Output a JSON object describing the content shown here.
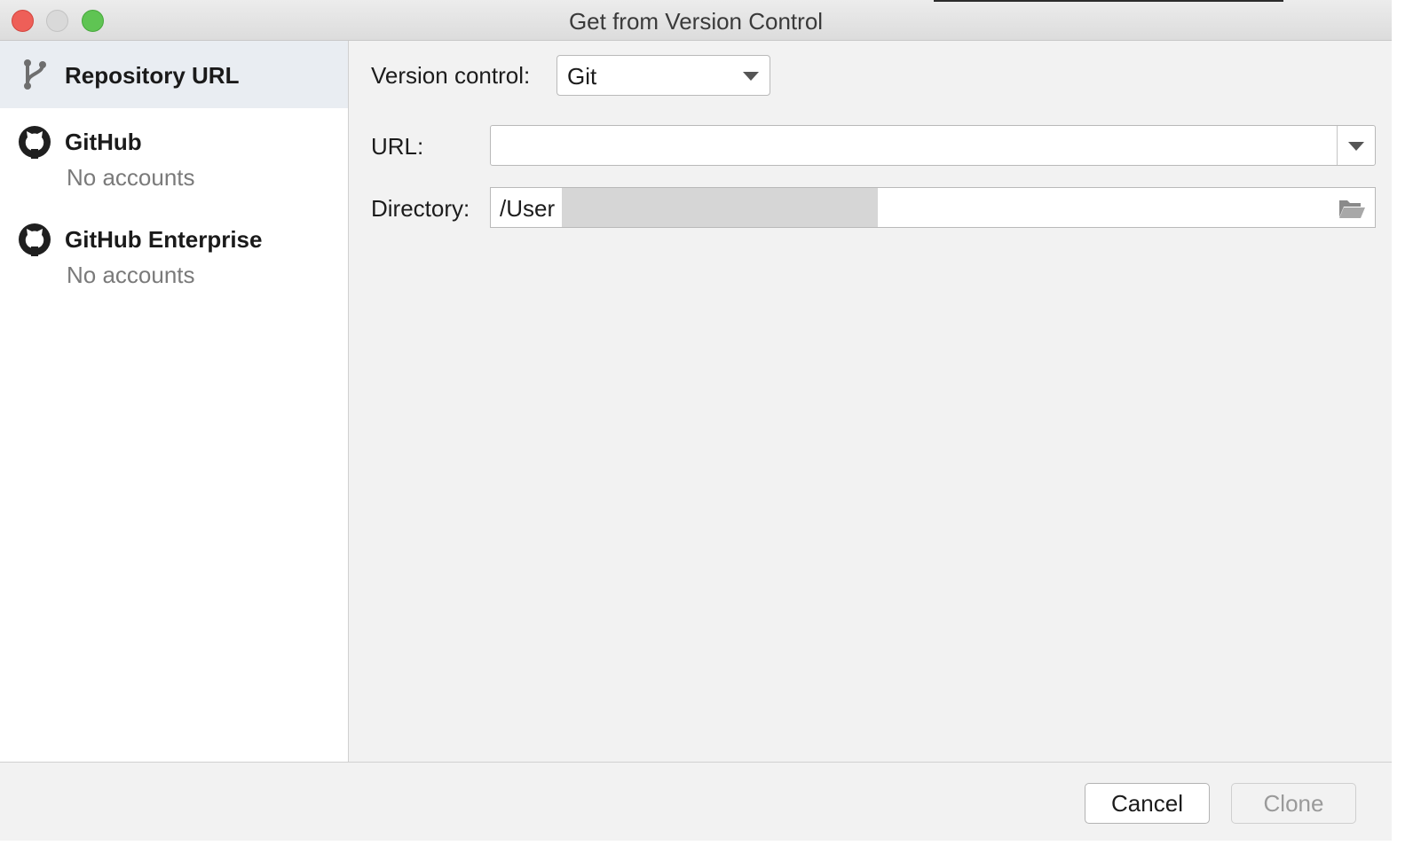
{
  "window": {
    "title": "Get from Version Control",
    "controls": [
      "close",
      "minimize",
      "maximize"
    ]
  },
  "sidebar": {
    "items": [
      {
        "label": "Repository URL",
        "subtitle": "",
        "icon": "vcs-branch-icon",
        "selected": true
      },
      {
        "label": "GitHub",
        "subtitle": "No accounts",
        "icon": "github-icon",
        "selected": false
      },
      {
        "label": "GitHub Enterprise",
        "subtitle": "No accounts",
        "icon": "github-icon",
        "selected": false
      }
    ]
  },
  "form": {
    "version_control": {
      "label": "Version control:",
      "value": "Git"
    },
    "url": {
      "label": "URL:",
      "value": ""
    },
    "directory": {
      "label": "Directory:",
      "value": "/User",
      "icon": "folder-open-icon"
    }
  },
  "footer": {
    "cancel_label": "Cancel",
    "clone_label": "Clone",
    "clone_enabled": false
  },
  "colors": {
    "selected_item_bg": "#e9edf2",
    "close": "#ee5f58",
    "maximize": "#5fc453"
  }
}
